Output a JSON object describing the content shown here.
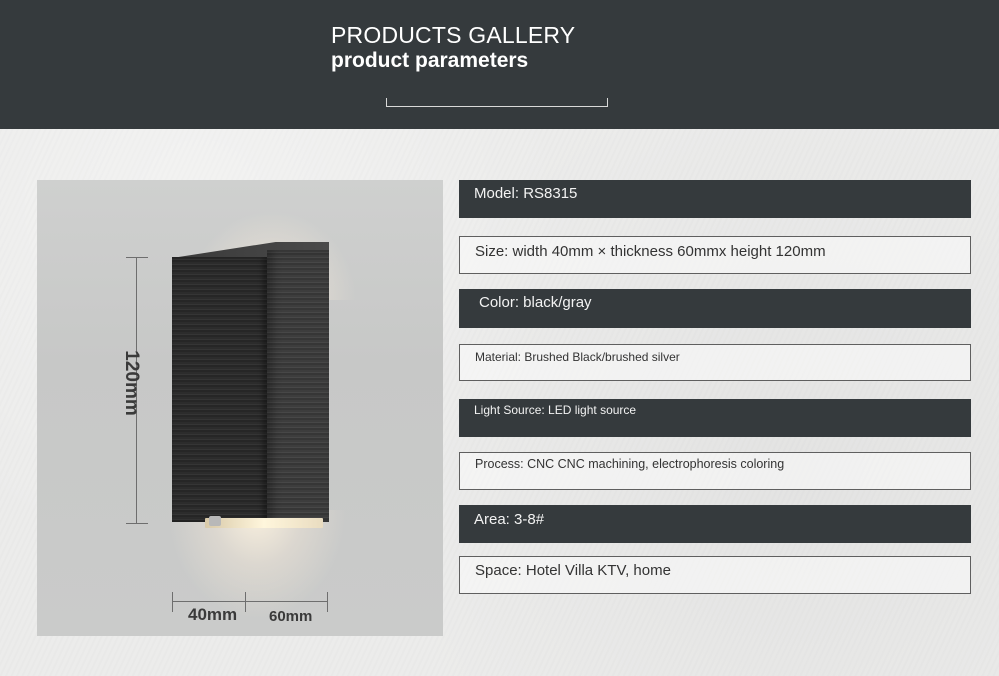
{
  "header": {
    "title": "PRODUCTS GALLERY",
    "subtitle": "product parameters"
  },
  "product_image": {
    "height_label": "120mm",
    "width_label": "40mm",
    "depth_label": "60mm"
  },
  "specs": [
    {
      "text": "Model: RS8315",
      "style": "dark"
    },
    {
      "text": "Size: width 40mm × thickness 60mmx height 120mm",
      "style": "light"
    },
    {
      "text": "Color: black/gray",
      "style": "dark"
    },
    {
      "text": "Material: Brushed Black/brushed silver",
      "style": "light"
    },
    {
      "text": "Light Source: LED light source",
      "style": "dark"
    },
    {
      "text": "Process: CNC CNC machining, electrophoresis coloring",
      "style": "light"
    },
    {
      "text": "Area: 3-8#",
      "style": "dark"
    },
    {
      "text": "Space: Hotel Villa KTV, home",
      "style": "light"
    }
  ],
  "colors": {
    "banner": "#353a3d",
    "background": "#ececeb",
    "text_light": "#ffffff",
    "text_dark": "#333333"
  }
}
